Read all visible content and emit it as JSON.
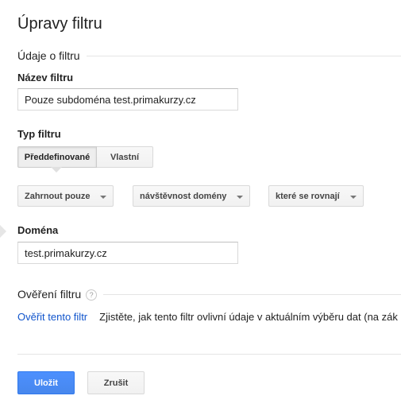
{
  "page": {
    "title": "Úpravy filtru"
  },
  "section_filter_info": {
    "label": "Údaje o filtru"
  },
  "filter_name": {
    "label": "Název filtru",
    "value": "Pouze subdoména test.primakurzy.cz"
  },
  "filter_type": {
    "label": "Typ filtru",
    "options": [
      "Předdefinované",
      "Vlastní"
    ],
    "selected": "Předdefinované"
  },
  "dropdowns": {
    "include": "Zahrnout pouze",
    "source": "návštěvnost domény",
    "condition": "které se rovnají"
  },
  "domain": {
    "label": "Doména",
    "value": "test.primakurzy.cz"
  },
  "verification": {
    "label": "Ověření filtru",
    "help_icon": "help-icon",
    "help_glyph": "?",
    "link": "Ověřit tento filtr",
    "description": "Zjistěte, jak tento filtr ovlivní údaje v aktuálním výběru dat (na zák"
  },
  "buttons": {
    "save": "Uložit",
    "cancel": "Zrušit"
  },
  "colors": {
    "primary_button": "#4d90fe",
    "link": "#1155cc"
  }
}
